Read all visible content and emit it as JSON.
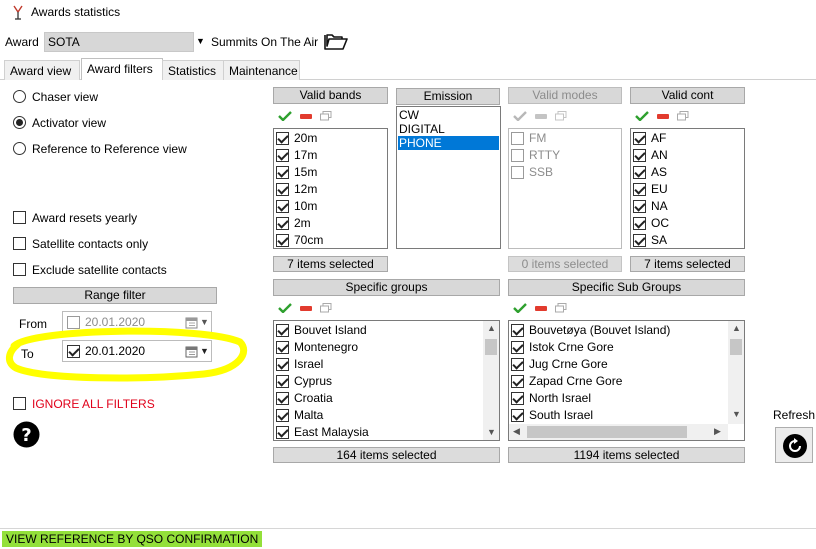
{
  "window": {
    "title": "Awards statistics"
  },
  "award": {
    "label": "Award",
    "value": "SOTA",
    "description": "Summits On The Air"
  },
  "tabs": [
    {
      "label": "Award view",
      "active": false
    },
    {
      "label": "Award filters",
      "active": true
    },
    {
      "label": "Statistics",
      "active": false
    },
    {
      "label": "Maintenance",
      "active": false
    }
  ],
  "views": [
    {
      "label": "Chaser view",
      "selected": false
    },
    {
      "label": "Activator view",
      "selected": true
    },
    {
      "label": "Reference to Reference view",
      "selected": false
    }
  ],
  "options": [
    {
      "label": "Award resets yearly",
      "checked": false
    },
    {
      "label": "Satellite contacts only",
      "checked": false
    },
    {
      "label": "Exclude satellite contacts",
      "checked": false
    }
  ],
  "range_filter": {
    "title": "Range filter",
    "from_label": "From",
    "from_value": "20.01.2020",
    "from_checked": false,
    "to_label": "To",
    "to_value": "20.01.2020",
    "to_checked": true
  },
  "ignore_filters": {
    "label": "IGNORE ALL FILTERS",
    "color": "#e0001a"
  },
  "valid_bands": {
    "title": "Valid bands",
    "items": [
      "20m",
      "17m",
      "15m",
      "12m",
      "10m",
      "2m",
      "70cm"
    ],
    "count": "7 items selected"
  },
  "emission": {
    "title": "Emission",
    "items": [
      "CW",
      "DIGITAL",
      "PHONE"
    ],
    "selected": "PHONE"
  },
  "valid_modes": {
    "title": "Valid modes",
    "items": [
      "FM",
      "RTTY",
      "SSB"
    ],
    "count": "0 items selected"
  },
  "valid_cont": {
    "title": "Valid cont",
    "items": [
      "AF",
      "AN",
      "AS",
      "EU",
      "NA",
      "OC",
      "SA"
    ],
    "count": "7 items selected"
  },
  "specific_groups": {
    "title": "Specific groups",
    "items": [
      "Bouvet Island",
      "Montenegro",
      "Israel",
      "Cyprus",
      "Croatia",
      "Malta",
      "East Malaysia"
    ],
    "count": "164 items selected"
  },
  "specific_sub_groups": {
    "title": "Specific Sub Groups",
    "items": [
      "Bouvetøya (Bouvet Island)",
      "Istok Crne Gore",
      "Jug Crne Gore",
      "Zapad Crne Gore",
      "North Israel",
      "South Israel"
    ],
    "count": "1194 items selected"
  },
  "refresh": {
    "label": "Refresh"
  },
  "status": {
    "text": "VIEW REFERENCE BY QSO CONFIRMATION",
    "highlight": "#93e03a"
  },
  "icons": {
    "app": "antenna-icon",
    "folder": "folder-open-icon",
    "help": "help-icon",
    "refresh": "refresh-icon",
    "calendar": "calendar-icon",
    "select_all": "check-all-icon",
    "clear": "clear-all-icon",
    "copy": "copy-icon"
  },
  "annotation": {
    "color": "#ffff00"
  }
}
